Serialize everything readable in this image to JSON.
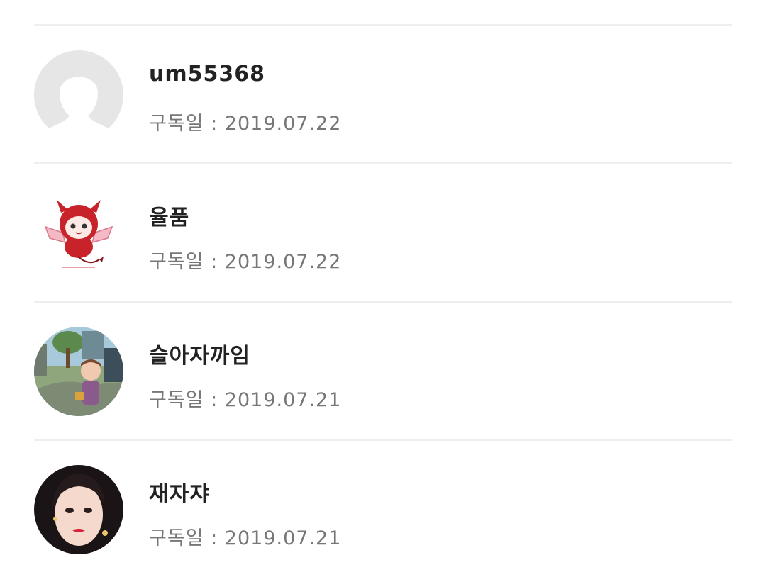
{
  "subscribers": [
    {
      "name": "um55368",
      "date": "구독일 : 2019.07.22",
      "avatar": "default-profile-icon"
    },
    {
      "name": "율품",
      "date": "구독일 : 2019.07.22",
      "avatar": "red-devil-character"
    },
    {
      "name": "슬아자까임",
      "date": "구독일 : 2019.07.21",
      "avatar": "cartoon-park-character"
    },
    {
      "name": "재자쟈",
      "date": "구독일 : 2019.07.21",
      "avatar": "portrait-photo"
    }
  ],
  "colors": {
    "divider": "#eeeeee",
    "name_text": "#222222",
    "date_text": "#777777",
    "default_avatar_bg": "#e6e6e6"
  }
}
